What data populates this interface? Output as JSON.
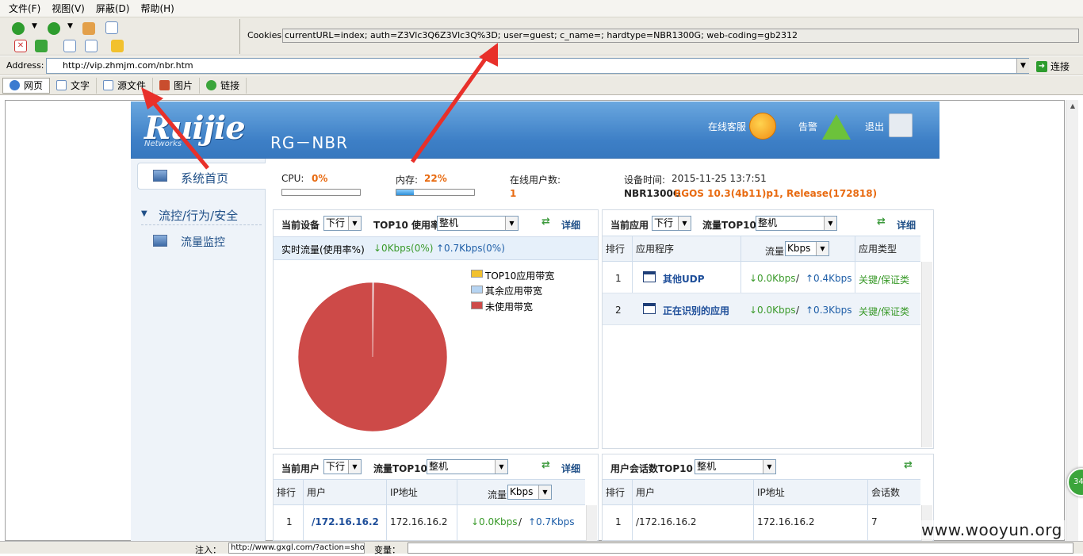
{
  "menubar": {
    "items": [
      "文件(F)",
      "视图(V)",
      "屏蔽(D)",
      "帮助(H)"
    ]
  },
  "cookies": {
    "label": "Cookies:",
    "value": "currentURL=index; auth=Z3Vlc3Q6Z3Vlc3Q%3D; user=guest; c_name=; hardtype=NBR1300G; web-coding=gb2312"
  },
  "address": {
    "label": "Address:",
    "url": "http://vip.zhmjm.com/nbr.htm",
    "go_label": "连接"
  },
  "tabs": [
    {
      "label": "网页",
      "icon": "ie-icon"
    },
    {
      "label": "文字",
      "icon": "text-doc-icon"
    },
    {
      "label": "源文件",
      "icon": "source-file-icon"
    },
    {
      "label": "图片",
      "icon": "image-icon"
    },
    {
      "label": "链接",
      "icon": "globe-icon"
    }
  ],
  "bottom": {
    "inject_label": "注入：",
    "inject_value": "http://www.gxgl.com/?action=show",
    "var_label": "变量："
  },
  "watermark": "www.wooyun.org",
  "badge": "34",
  "router": {
    "logo": "Ruijie",
    "logo_sub": "Networks",
    "model": "RG－NBR",
    "online_service": "在线客服",
    "alarm": "告警",
    "logout": "退出",
    "sidebar": {
      "home": "系统首页",
      "group": "流控/行为/安全",
      "monitor": "流量监控"
    },
    "sys": {
      "cpu_label": "CPU:",
      "cpu_value": "0%",
      "cpu_fraction": 0,
      "mem_label": "内存:",
      "mem_value": "22%",
      "mem_fraction": 0.22,
      "online_label": "在线用户数:",
      "online_value": "1",
      "time_label": "设备时间:",
      "time_value": "2015-11-25 13:7:51",
      "device": "NBR1300G",
      "version": "RGOS 10.3(4b11)p1, Release(172818)"
    },
    "panel_device": {
      "title": "当前设备",
      "sel1": "下行",
      "title2": "TOP10 使用率",
      "sel2": "整机",
      "detail": "详细",
      "realtime_label": "实时流量(使用率%)",
      "down": "↓0Kbps(0%)",
      "up": "↑0.7Kbps(0%)"
    },
    "chart_data": {
      "type": "pie",
      "legend": [
        "TOP10应用带宽",
        "其余应用带宽",
        "未使用带宽"
      ],
      "colors": [
        "#f2c12e",
        "#b6d4f2",
        "#cd4a48"
      ],
      "values": [
        0,
        0.2,
        99.8
      ]
    },
    "panel_app": {
      "title": "当前应用",
      "sel1": "下行",
      "title2": "流量TOP10",
      "sel2": "整机",
      "detail": "详细",
      "headers": [
        "排行",
        "应用程序",
        "流量",
        "Kbps",
        "应用类型"
      ],
      "rows": [
        {
          "rank": "1",
          "app": "其他UDP",
          "down": "↓0.0Kbps",
          "sep": "/",
          "up": "↑0.4Kbps",
          "type": "关键/保证类"
        },
        {
          "rank": "2",
          "app": "正在识别的应用",
          "down": "↓0.0Kbps",
          "sep": "/",
          "up": "↑0.3Kbps",
          "type": "关键/保证类"
        }
      ]
    },
    "panel_user": {
      "title": "当前用户",
      "sel1": "下行",
      "title2": "流量TOP10",
      "sel2": "整机",
      "detail": "详细",
      "headers": [
        "排行",
        "用户",
        "IP地址",
        "流量",
        "Kbps"
      ],
      "rows": [
        {
          "rank": "1",
          "user": "/172.16.16.2",
          "ip": "172.16.16.2",
          "down": "↓0.0Kbps",
          "sep": "/",
          "up": "↑0.7Kbps"
        }
      ]
    },
    "panel_session": {
      "title": "用户会话数TOP10",
      "sel": "整机",
      "headers": [
        "排行",
        "用户",
        "IP地址",
        "会话数"
      ],
      "rows": [
        {
          "rank": "1",
          "user": "/172.16.16.2",
          "ip": "172.16.16.2",
          "count": "7"
        }
      ]
    }
  }
}
